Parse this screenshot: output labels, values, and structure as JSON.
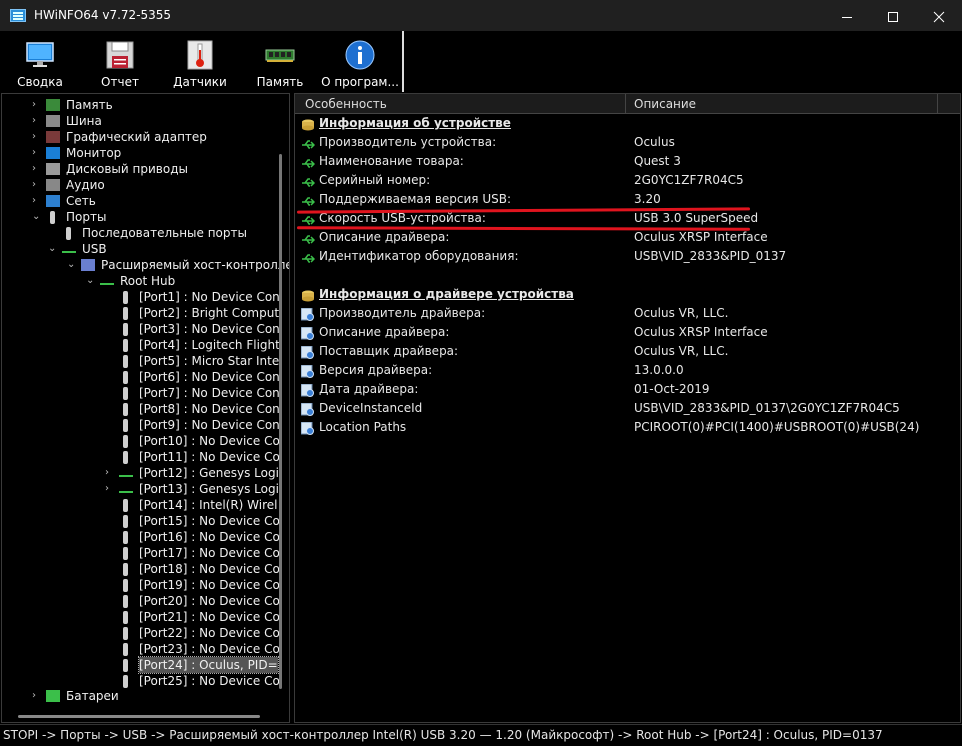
{
  "window": {
    "title": "HWiNFO64 v7.72-5355"
  },
  "toolbar": {
    "buttons": [
      {
        "label": "Сводка",
        "icon": "monitor-icon"
      },
      {
        "label": "Отчет",
        "icon": "floppy-disk-icon"
      },
      {
        "label": "Датчики",
        "icon": "thermometer-icon"
      },
      {
        "label": "Память",
        "icon": "memory-module-icon"
      },
      {
        "label": "О програм...",
        "icon": "info-icon"
      }
    ]
  },
  "tree": {
    "items": [
      {
        "label": "Память",
        "depth": 0,
        "expander": "›",
        "icon": "memory-icon"
      },
      {
        "label": "Шина",
        "depth": 0,
        "expander": "›",
        "icon": "bus-icon"
      },
      {
        "label": "Графический адаптер",
        "depth": 0,
        "expander": "›",
        "icon": "gpu-icon"
      },
      {
        "label": "Монитор",
        "depth": 0,
        "expander": "›",
        "icon": "monitor-icon"
      },
      {
        "label": "Дисковый приводы",
        "depth": 0,
        "expander": "›",
        "icon": "disk-icon"
      },
      {
        "label": "Аудио",
        "depth": 0,
        "expander": "›",
        "icon": "speaker-icon"
      },
      {
        "label": "Сеть",
        "depth": 0,
        "expander": "›",
        "icon": "network-icon"
      },
      {
        "label": "Порты",
        "depth": 0,
        "expander": "⌄",
        "icon": "port-icon"
      },
      {
        "label": "Последовательные порты",
        "depth": 1,
        "expander": "",
        "icon": "port-icon"
      },
      {
        "label": "USB",
        "depth": 1,
        "expander": "⌄",
        "icon": "usb-icon"
      },
      {
        "label": "Расширяемый хост-контроллер",
        "depth": 2,
        "expander": "⌄",
        "icon": "usb-controller-icon"
      },
      {
        "label": "Root Hub",
        "depth": 3,
        "expander": "⌄",
        "icon": "usb-icon"
      },
      {
        "label": "[Port1] : No Device Con",
        "depth": 4,
        "expander": "",
        "icon": "port-icon"
      },
      {
        "label": "[Port2] : Bright Comput",
        "depth": 4,
        "expander": "",
        "icon": "port-icon"
      },
      {
        "label": "[Port3] : No Device Con",
        "depth": 4,
        "expander": "",
        "icon": "port-icon"
      },
      {
        "label": "[Port4] : Logitech Flight",
        "depth": 4,
        "expander": "",
        "icon": "port-icon"
      },
      {
        "label": "[Port5] : Micro Star Inte",
        "depth": 4,
        "expander": "",
        "icon": "port-icon"
      },
      {
        "label": "[Port6] : No Device Con",
        "depth": 4,
        "expander": "",
        "icon": "port-icon"
      },
      {
        "label": "[Port7] : No Device Con",
        "depth": 4,
        "expander": "",
        "icon": "port-icon"
      },
      {
        "label": "[Port8] : No Device Con",
        "depth": 4,
        "expander": "",
        "icon": "port-icon"
      },
      {
        "label": "[Port9] : No Device Con",
        "depth": 4,
        "expander": "",
        "icon": "port-icon"
      },
      {
        "label": "[Port10] : No Device Co",
        "depth": 4,
        "expander": "",
        "icon": "port-icon"
      },
      {
        "label": "[Port11] : No Device Co",
        "depth": 4,
        "expander": "",
        "icon": "port-icon"
      },
      {
        "label": "[Port12] : Genesys Logi",
        "depth": 4,
        "expander": "›",
        "icon": "usb-icon"
      },
      {
        "label": "[Port13] : Genesys Logi",
        "depth": 4,
        "expander": "›",
        "icon": "usb-icon"
      },
      {
        "label": "[Port14] : Intel(R) Wirel",
        "depth": 4,
        "expander": "",
        "icon": "port-icon"
      },
      {
        "label": "[Port15] : No Device Co",
        "depth": 4,
        "expander": "",
        "icon": "port-icon"
      },
      {
        "label": "[Port16] : No Device Co",
        "depth": 4,
        "expander": "",
        "icon": "port-icon"
      },
      {
        "label": "[Port17] : No Device Co",
        "depth": 4,
        "expander": "",
        "icon": "port-icon"
      },
      {
        "label": "[Port18] : No Device Co",
        "depth": 4,
        "expander": "",
        "icon": "port-icon"
      },
      {
        "label": "[Port19] : No Device Co",
        "depth": 4,
        "expander": "",
        "icon": "port-icon"
      },
      {
        "label": "[Port20] : No Device Co",
        "depth": 4,
        "expander": "",
        "icon": "port-icon"
      },
      {
        "label": "[Port21] : No Device Co",
        "depth": 4,
        "expander": "",
        "icon": "port-icon"
      },
      {
        "label": "[Port22] : No Device Co",
        "depth": 4,
        "expander": "",
        "icon": "port-icon"
      },
      {
        "label": "[Port23] : No Device Co",
        "depth": 4,
        "expander": "",
        "icon": "port-icon"
      },
      {
        "label": "[Port24] : Oculus, PID=",
        "depth": 4,
        "expander": "",
        "icon": "port-icon",
        "selected": true
      },
      {
        "label": "[Port25] : No Device Co",
        "depth": 4,
        "expander": "",
        "icon": "port-icon"
      },
      {
        "label": "Батареи",
        "depth": 0,
        "expander": "›",
        "icon": "battery-icon"
      }
    ]
  },
  "details": {
    "columns": {
      "feature": "Особенность",
      "description": "Описание"
    },
    "rows": [
      {
        "key": "Информация об устройстве",
        "value": "",
        "section": true,
        "icon": "device-info-icon"
      },
      {
        "key": "Производитель устройства:",
        "value": "Oculus",
        "icon": "usb-icon"
      },
      {
        "key": "Наименование товара:",
        "value": "Quest 3",
        "icon": "usb-icon"
      },
      {
        "key": "Серийный номер:",
        "value": "2G0YC1ZF7R04C5",
        "icon": "usb-icon"
      },
      {
        "key": "Поддерживаемая версия USB:",
        "value": "3.20",
        "icon": "usb-icon"
      },
      {
        "key": "Скорость USB-устройства:",
        "value": "USB 3.0 SuperSpeed",
        "icon": "usb-icon"
      },
      {
        "key": "Описание драйвера:",
        "value": "Oculus XRSP Interface",
        "icon": "usb-icon"
      },
      {
        "key": "Идентификатор оборудования:",
        "value": "USB\\VID_2833&PID_0137",
        "icon": "usb-icon"
      },
      {
        "key": "",
        "value": "",
        "blank": true
      },
      {
        "key": "Информация о драйвере устройства",
        "value": "",
        "section": true,
        "icon": "driver-info-icon"
      },
      {
        "key": "Производитель драйвера:",
        "value": "Oculus VR, LLC.",
        "icon": "driver-gear-icon"
      },
      {
        "key": "Описание драйвера:",
        "value": "Oculus XRSP Interface",
        "icon": "driver-gear-icon"
      },
      {
        "key": "Поставщик драйвера:",
        "value": "Oculus VR, LLC.",
        "icon": "driver-gear-icon"
      },
      {
        "key": "Версия драйвера:",
        "value": "13.0.0.0",
        "icon": "driver-gear-icon"
      },
      {
        "key": "Дата драйвера:",
        "value": "01-Oct-2019",
        "icon": "driver-gear-icon"
      },
      {
        "key": "DeviceInstanceId",
        "value": "USB\\VID_2833&PID_0137\\2G0YC1ZF7R04C5",
        "icon": "driver-gear-icon"
      },
      {
        "key": "Location Paths",
        "value": "PCIROOT(0)#PCI(1400)#USBROOT(0)#USB(24)",
        "icon": "driver-gear-icon"
      }
    ]
  },
  "status_bar": {
    "text": "STOPI -> Порты -> USB -> Расширяемый хост-контроллер Intel(R) USB 3.20 — 1.20 (Майкрософт) -> Root Hub -> [Port24] : Oculus, PID=0137"
  },
  "colors": {
    "highlight_line": "#e0141e",
    "usb_green": "#3bbf4a",
    "background": "#000000"
  }
}
